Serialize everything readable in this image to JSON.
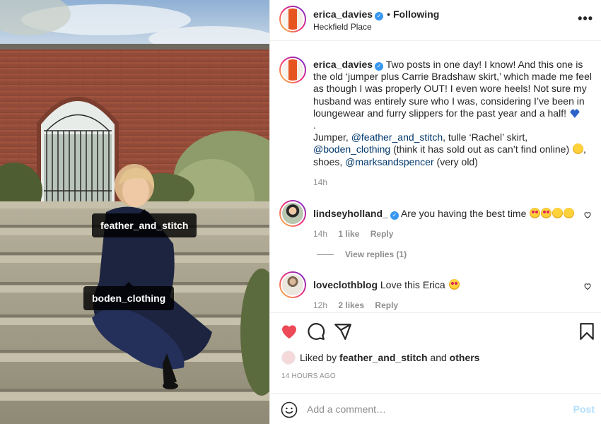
{
  "post": {
    "username": "erica_davies",
    "follow_separator": "•",
    "follow_status": "Following",
    "location": "Heckfield Place",
    "more_symbol": "•••"
  },
  "photo_tags": [
    {
      "label": "feather_and_stitch"
    },
    {
      "label": "boden_clothing"
    }
  ],
  "caption": {
    "username": "erica_davies",
    "text_main": "Two posts in one day! I know! And this one is the old ‘jumper plus Carrie Bradshaw skirt,’ which made me feel as though I was properly OUT! I even wore heels! Not sure my husband was entirely sure who I was, considering I’ve been in loungewear and furry slippers for the past year and a half!",
    "dot": ".",
    "text_jumper": "Jumper,",
    "mention_1": "@feather_and_stitch",
    "text_skirt": ", tulle ‘Rachel’ skirt,",
    "mention_2": "@boden_clothing",
    "text_sold": "(think it has sold out as can’t find online)",
    "text_shoes": ", shoes,",
    "mention_3": "@marksandspencer",
    "text_old": "(very old)",
    "time": "14h"
  },
  "comments": [
    {
      "username": "lindseyholland_",
      "text": "Are you having the best time",
      "time": "14h",
      "likes": "1 like",
      "reply": "Reply"
    },
    {
      "username": "loveclothblog",
      "text": "Love this Erica",
      "time": "12h",
      "likes": "2 likes",
      "reply": "Reply"
    }
  ],
  "view_replies": "View replies (1)",
  "likes_line": {
    "prefix": "Liked by",
    "user": "feather_and_stitch",
    "and": "and",
    "others": "others"
  },
  "post_age": "14 HOURS AGO",
  "add_comment": {
    "placeholder": "Add a comment…",
    "post_label": "Post"
  },
  "colors": {
    "like_red": "#ed4956",
    "link_blue": "#00376b",
    "verified_blue": "#3897f0",
    "post_button_disabled": "#b2dffc"
  }
}
